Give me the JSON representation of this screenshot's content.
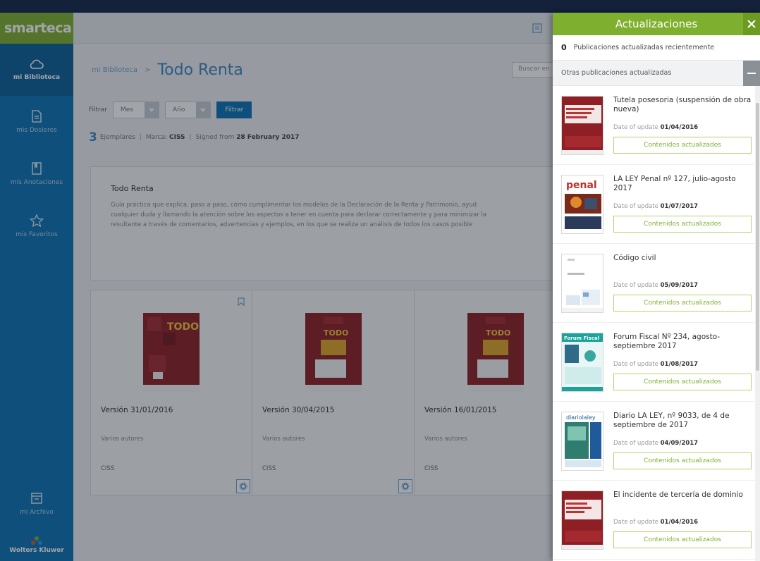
{
  "brand": {
    "logo": "smarteca",
    "footer": "Wolters Kluwer"
  },
  "sidebar": {
    "items": [
      {
        "label": "mi Biblioteca",
        "icon": "cloud-icon"
      },
      {
        "label": "mis Dosieres",
        "icon": "document-icon"
      },
      {
        "label": "mis Anotaciones",
        "icon": "notebook-icon"
      },
      {
        "label": "mis Favoritos",
        "icon": "star-icon"
      }
    ],
    "archive": "mi Archivo"
  },
  "breadcrumb": {
    "parent": "mi Biblioteca",
    "separator": ">",
    "title": "Todo Renta"
  },
  "search": {
    "placeholder": "Buscar en"
  },
  "filter": {
    "label": "Filtrar",
    "month": "Mes",
    "year": "Año",
    "button": "Filtrar"
  },
  "summary": {
    "count": "3",
    "copies": "Ejemplares",
    "brand_label": "Marca:",
    "brand_value": "CISS",
    "signed_label": "Signed from",
    "signed_value": "28 February 2017"
  },
  "description": {
    "title": "Todo Renta",
    "lines": [
      "Guía práctica que explica, paso a paso, cómo cumplimentar los modelos de la Declaración de la Renta y Patrimonio, ayud",
      "cualquier duda y llamando la atención sobre los aspectos a tener en cuenta para declarar correctamente y para minimizar la",
      "resultante a través de comentarios, advertencias y ejemplos, en los que se realiza un análisis de todos los casos posible"
    ]
  },
  "versions": [
    {
      "name": "Versión 31/01/2016",
      "authors": "Varios autores",
      "publisher": "CISS",
      "cover": "TODO"
    },
    {
      "name": "Versión 30/04/2015",
      "authors": "Varios autores",
      "publisher": "CISS",
      "cover": "TODO"
    },
    {
      "name": "Versión 16/01/2015",
      "authors": "Varios autores",
      "publisher": "CISS",
      "cover": "TODO"
    }
  ],
  "panel": {
    "title": "Actualizaciones",
    "recent_count": "0",
    "recent_label": "Publicaciones actualizadas recientemente",
    "other_label": "Otras publicaciones actualizadas",
    "date_label": "Date of update",
    "button_label": "Contenidos actualizados",
    "items": [
      {
        "title": "Tutela posesoria (suspensión de obra nueva)",
        "date": "01/04/2016",
        "thumb": "red"
      },
      {
        "title": "LA LEY Penal nº 127, julio-agosto 2017",
        "date": "01/07/2017",
        "thumb": "penal"
      },
      {
        "title": "Código civil",
        "date": "05/09/2017",
        "thumb": "white"
      },
      {
        "title": "Forum Fiscal Nº 234, agosto-septiembre 2017",
        "date": "01/08/2017",
        "thumb": "fiscal"
      },
      {
        "title": "Diario LA LEY, nº 9033, de 4 de septiembre de 2017",
        "date": "04/09/2017",
        "thumb": "diario"
      },
      {
        "title": "El incidente de tercería de dominio",
        "date": "01/04/2016",
        "thumb": "red"
      }
    ]
  },
  "colors": {
    "brand_green": "#7faf2e",
    "sidebar_blue": "#0d72b3",
    "cover_red": "#8e1f24"
  }
}
